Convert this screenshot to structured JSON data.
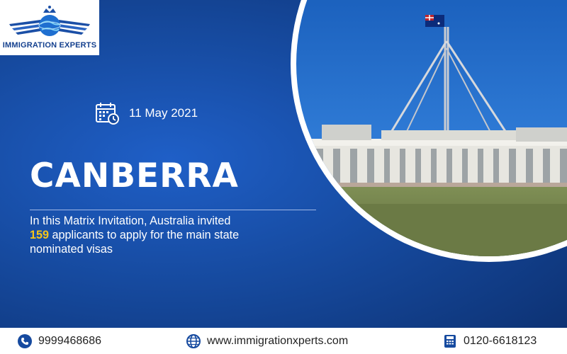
{
  "brand": {
    "name": "IMMIGRATION EXPERTS",
    "colors": {
      "primary": "#164a9f",
      "accent": "#f5c518",
      "white": "#ffffff"
    }
  },
  "hero": {
    "date_icon": "calendar-clock-icon",
    "date": "11 May 2021",
    "city": "CANBERRA",
    "description": {
      "line1": "In this Matrix Invitation, Australia invited",
      "highlight": "159",
      "line2_rest": " applicants to apply for the main state",
      "line3": "nominated visas"
    }
  },
  "footer": {
    "phone": {
      "icon": "phone-icon",
      "text": "9999468686"
    },
    "website": {
      "icon": "globe-icon",
      "text": "www.immigrationxperts.com"
    },
    "landline": {
      "icon": "telephone-icon",
      "text": "0120-6618123"
    }
  }
}
